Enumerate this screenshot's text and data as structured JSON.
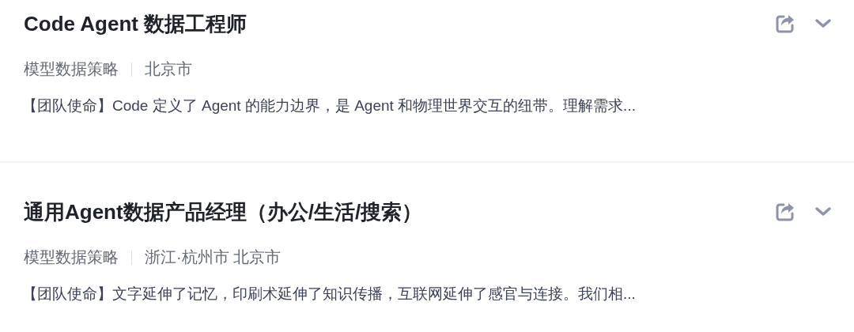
{
  "jobs": [
    {
      "title": "Code Agent 数据工程师",
      "department": "模型数据策略",
      "location": "北京市",
      "description": "【团队使命】Code 定义了 Agent 的能力边界，是 Agent 和物理世界交互的纽带。理解需求..."
    },
    {
      "title": "通用Agent数据产品经理（办公/生活/搜索）",
      "department": "模型数据策略",
      "location": "浙江·杭州市 北京市",
      "description": "【团队使命】文字延伸了记忆，印刷术延伸了知识传播，互联网延伸了感官与连接。我们相..."
    }
  ]
}
